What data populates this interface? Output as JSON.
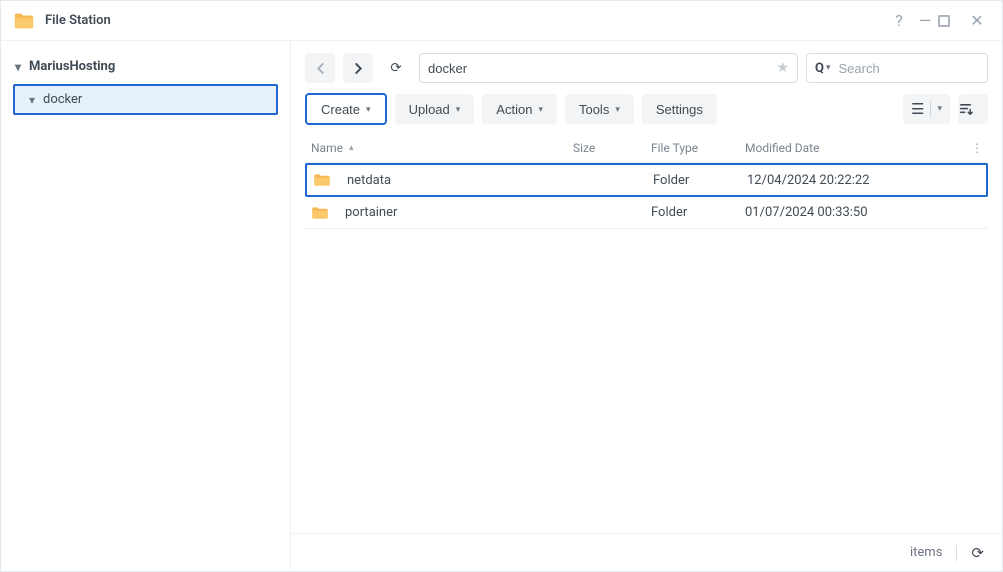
{
  "window": {
    "title": "File Station"
  },
  "sidebar": {
    "root": "MariusHosting",
    "selected_child": "docker"
  },
  "toolbar": {
    "path_value": "docker",
    "search_placeholder": "Search",
    "create_label": "Create",
    "upload_label": "Upload",
    "action_label": "Action",
    "tools_label": "Tools",
    "settings_label": "Settings"
  },
  "columns": {
    "name": "Name",
    "size": "Size",
    "type": "File Type",
    "date": "Modified Date"
  },
  "rows": [
    {
      "name": "netdata",
      "size": "",
      "type": "Folder",
      "date": "12/04/2024 20:22:22",
      "selected": true
    },
    {
      "name": "portainer",
      "size": "",
      "type": "Folder",
      "date": "01/07/2024 00:33:50",
      "selected": false
    }
  ],
  "statusbar": {
    "items_label": "items"
  }
}
